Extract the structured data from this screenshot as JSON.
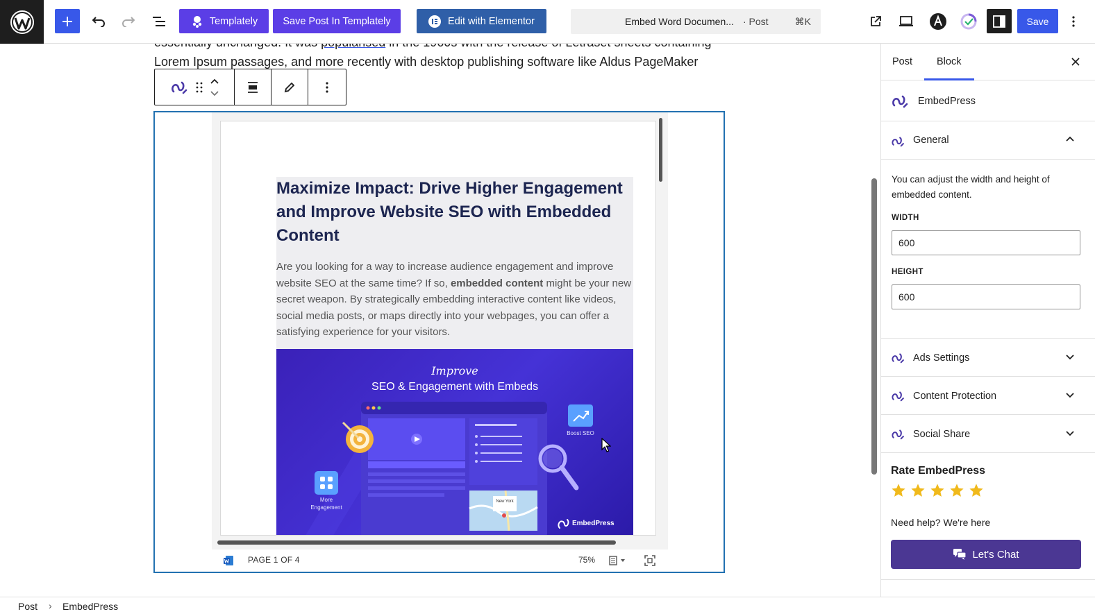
{
  "topbar": {
    "templately_label": "Templately",
    "save_post_templately_label": "Save Post In Templately",
    "elementor_label": "Edit with Elementor",
    "command_bar": {
      "title": "Embed Word Documen...",
      "type": "· Post",
      "shortcut": "⌘K"
    },
    "save_label": "Save"
  },
  "editor": {
    "paragraph_cut_before": "essentially unchanged. It was ",
    "paragraph_cut_link": "popularised",
    "paragraph_cut_after": " in the 1960s with the release of Letraset sheets containing",
    "paragraph_line": "Lorem Ipsum passages, and more recently with desktop publishing software like Aldus PageMaker"
  },
  "document": {
    "heading": "Maximize Impact: Drive Higher Engagement and Improve Website SEO with Embedded Content",
    "body_before": "Are you looking for a way to increase audience engagement and improve website SEO at the same time? If so, ",
    "body_bold": "embedded content",
    "body_after": " might be your new secret weapon. By strategically embedding interactive content like videos, social media posts, or maps directly into your webpages, you can offer a satisfying experience for your visitors.",
    "image": {
      "script_word": "Improve",
      "caption": "SEO & Engagement with Embeds",
      "boost_label": "Boost SEO",
      "more_label": "More Engagement",
      "map_label": "New York",
      "brand": "EmbedPress"
    },
    "footer": {
      "page_indicator": "PAGE 1 OF 4",
      "zoom": "75%"
    }
  },
  "sidebar": {
    "tabs": {
      "post": "Post",
      "block": "Block"
    },
    "block_name": "EmbedPress",
    "general": {
      "title": "General",
      "description": "You can adjust the width and height of embedded content.",
      "width_label": "WIDTH",
      "width_value": "600",
      "height_label": "HEIGHT",
      "height_value": "600"
    },
    "panels": {
      "ads": "Ads Settings",
      "protection": "Content Protection",
      "social": "Social Share"
    },
    "rate": {
      "title": "Rate EmbedPress",
      "stars": 5,
      "help": "Need help? We're here",
      "chat_label": "Let's Chat"
    }
  },
  "breadcrumb": {
    "items": [
      "Post",
      "EmbedPress"
    ]
  },
  "colors": {
    "wp_blue": "#3858e9",
    "templately_purple": "#5b3ee6",
    "elementor_blue": "#2f5fa8",
    "embed_border": "#2271b1",
    "chat_purple": "#4b3793",
    "star_gold": "#f0b91b"
  }
}
